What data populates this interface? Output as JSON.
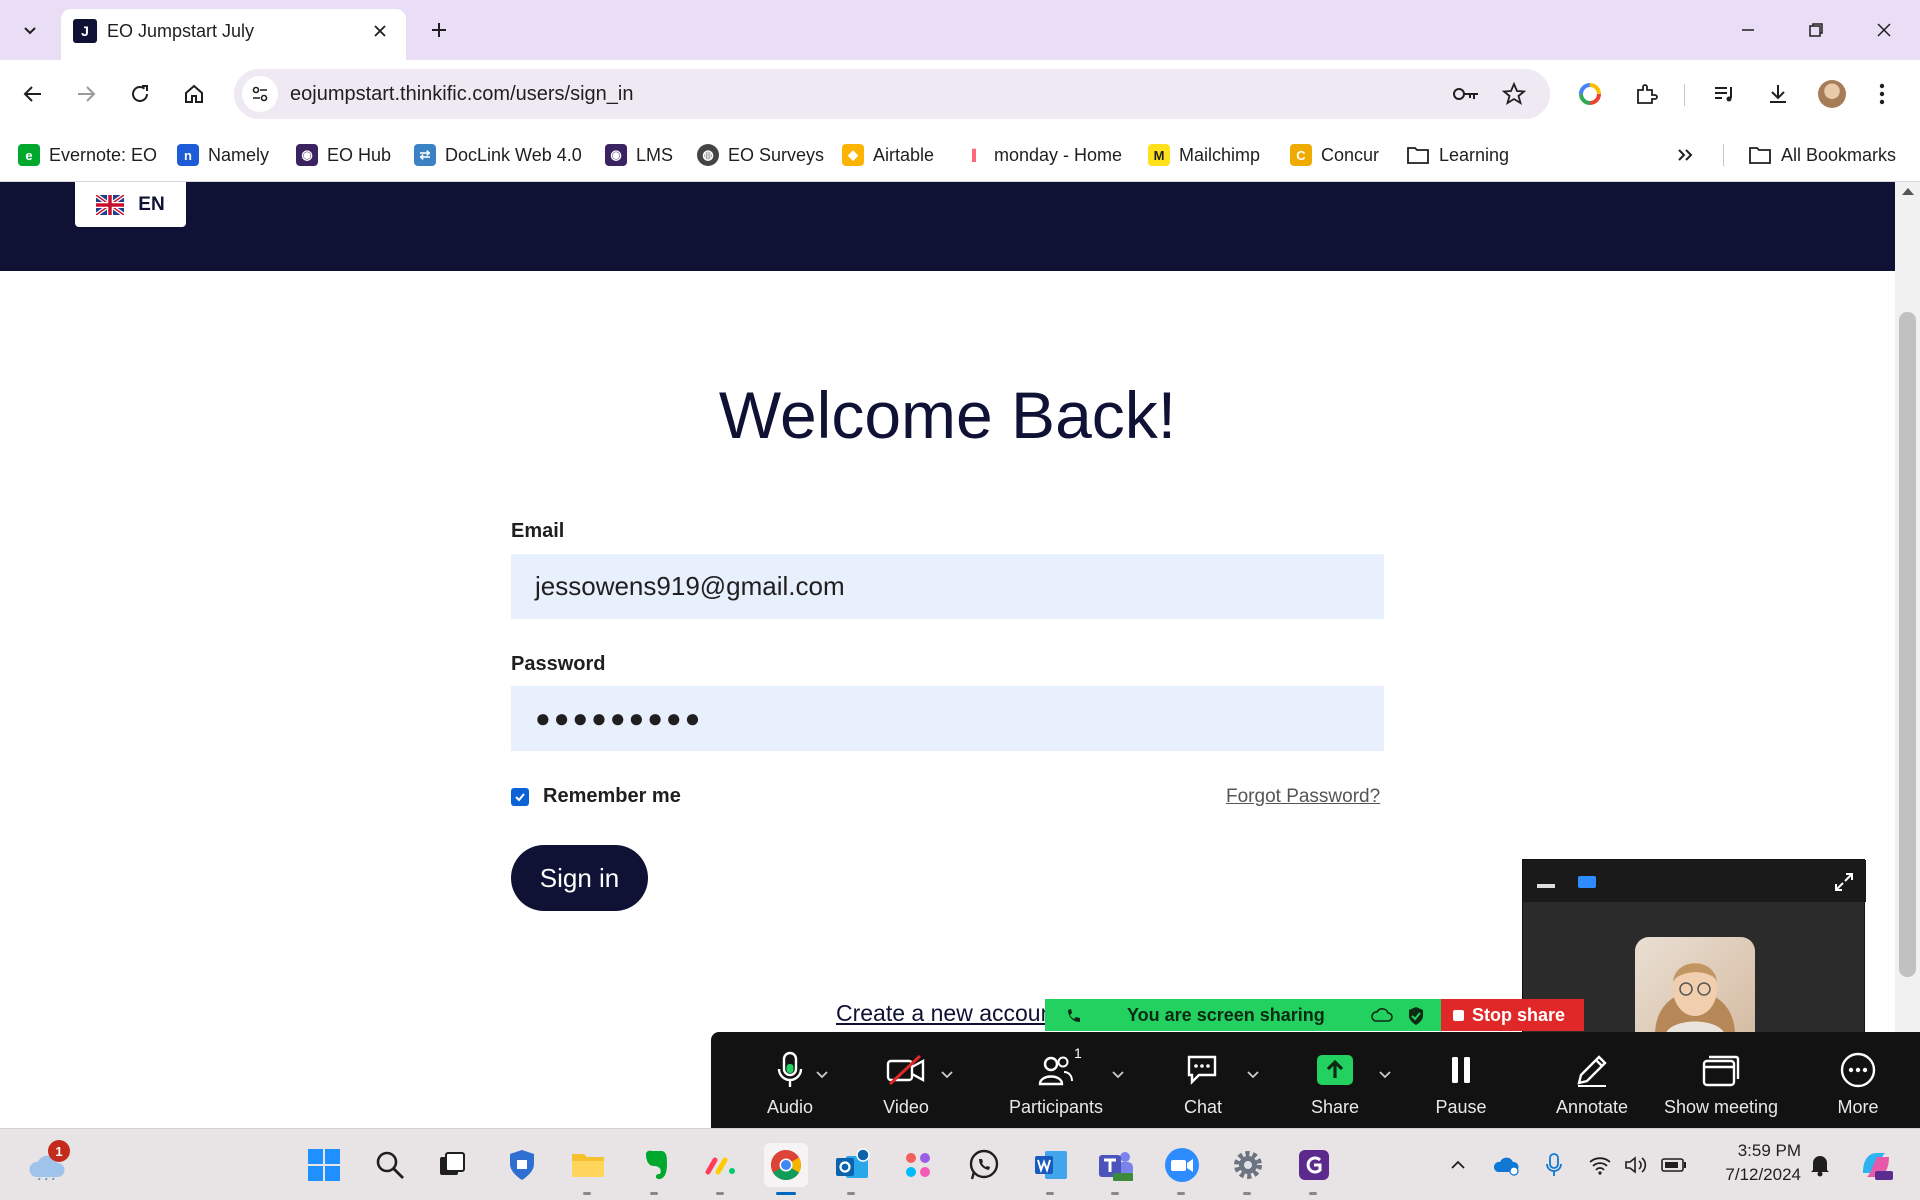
{
  "browser": {
    "tab": {
      "title": "EO Jumpstart July",
      "favicon_letter": "J"
    },
    "url": "eojumpstart.thinkific.com/users/sign_in",
    "bookmarks": [
      {
        "label": "Evernote: EO",
        "icon": "evernote-icon",
        "color": "#00a82d"
      },
      {
        "label": "Namely",
        "icon": "namely-icon",
        "color": "#1e5bd6"
      },
      {
        "label": "EO Hub",
        "icon": "eo-hub-icon",
        "color": "#3a2360"
      },
      {
        "label": "DocLink Web 4.0",
        "icon": "doclink-icon",
        "color": "#3b82c4"
      },
      {
        "label": "LMS",
        "icon": "lms-icon",
        "color": "#3a2360"
      },
      {
        "label": "EO Surveys",
        "icon": "globe-icon",
        "color": "#444444"
      },
      {
        "label": "Airtable",
        "icon": "airtable-icon",
        "color": "#fcb400"
      },
      {
        "label": "monday - Home",
        "icon": "monday-icon",
        "color": "#ff3d57"
      },
      {
        "label": "Mailchimp",
        "icon": "mailchimp-icon",
        "color": "#ffe01b"
      },
      {
        "label": "Concur",
        "icon": "concur-icon",
        "color": "#f0ab00"
      },
      {
        "label": "Learning",
        "icon": "folder-icon",
        "color": "#444444"
      }
    ],
    "all_bookmarks": "All Bookmarks"
  },
  "page": {
    "language": "EN",
    "heading": "Welcome Back!",
    "email_label": "Email",
    "email_value": "jessowens919@gmail.com",
    "password_label": "Password",
    "password_value": "●●●●●●●●●",
    "remember_label": "Remember me",
    "remember_checked": true,
    "forgot_label": "Forgot Password?",
    "signin_label": "Sign in",
    "create_account_label": "Create a new accoun"
  },
  "zoom": {
    "banner_text": "You are screen sharing",
    "stop_share": "Stop share",
    "participants_count": "1",
    "toolbar": [
      {
        "label": "Audio",
        "icon": "microphone-icon"
      },
      {
        "label": "Video",
        "icon": "video-off-icon"
      },
      {
        "label": "Participants",
        "icon": "participants-icon"
      },
      {
        "label": "Chat",
        "icon": "chat-icon"
      },
      {
        "label": "Share",
        "icon": "share-icon"
      },
      {
        "label": "Pause",
        "icon": "pause-icon"
      },
      {
        "label": "Annotate",
        "icon": "pencil-icon"
      },
      {
        "label": "Show meeting",
        "icon": "window-icon"
      },
      {
        "label": "More",
        "icon": "more-icon"
      }
    ]
  },
  "taskbar": {
    "weather_badge": "1",
    "time": "3:59 PM",
    "date": "7/12/2024"
  },
  "colors": {
    "brand_navy": "#0f1135",
    "input_bg": "#e8effd",
    "zoom_green": "#23d160",
    "zoom_red": "#e02828"
  }
}
